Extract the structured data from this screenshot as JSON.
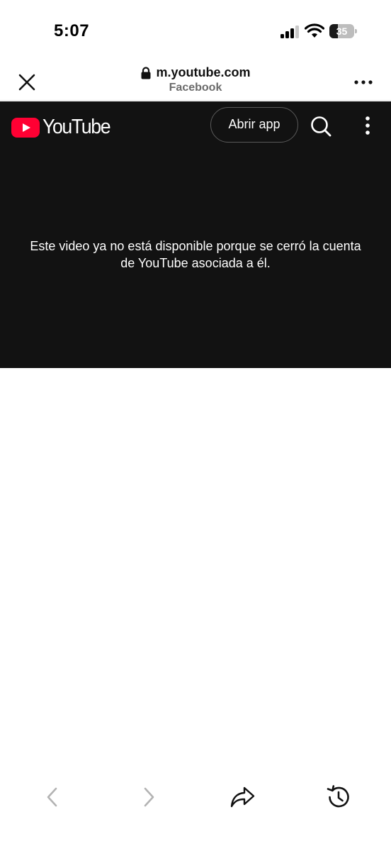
{
  "status_bar": {
    "time": "5:07",
    "battery_level": "35",
    "battery_fraction": 0.35,
    "signal_bars_active": 3,
    "signal_bars_total": 4
  },
  "browser": {
    "url": "m.youtube.com",
    "source": "Facebook",
    "icons": [
      "close-icon",
      "lock-icon",
      "more-icon"
    ]
  },
  "youtube": {
    "logo_text": "YouTube",
    "open_app_label": "Abrir app",
    "error_line_1": "Este video ya no está disponible porque se cerró la cuenta",
    "error_line_2": "de YouTube asociada a él.",
    "colors": {
      "background": "#121212",
      "brand_red": "#ff0033",
      "text": "#ffffff"
    },
    "icons": [
      "youtube-logo-icon",
      "search-icon",
      "vertical-dots-icon"
    ]
  },
  "toolbar": {
    "icons": [
      "back-icon",
      "forward-icon",
      "share-icon",
      "history-icon"
    ],
    "disabled_color": "#b3b3b3",
    "active_color": "#111111"
  }
}
